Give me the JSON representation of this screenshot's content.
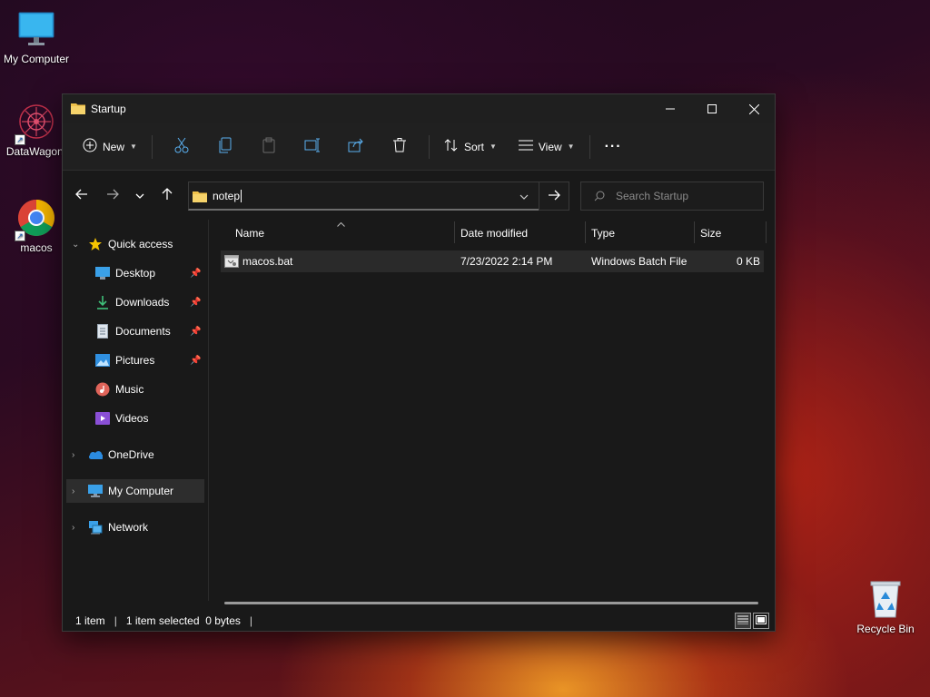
{
  "desktop": {
    "icons": [
      {
        "label": "My Computer",
        "icon": "monitor-icon"
      },
      {
        "label": "DataWagon.",
        "icon": "datawagon-icon"
      },
      {
        "label": "macos",
        "icon": "chrome-icon"
      },
      {
        "label": "Recycle Bin",
        "icon": "recycle-bin-icon"
      }
    ]
  },
  "window": {
    "title": "Startup",
    "toolbar": {
      "new_label": "New",
      "sort_label": "Sort",
      "view_label": "View"
    },
    "address": {
      "value": "notep"
    },
    "search": {
      "placeholder": "Search Startup"
    },
    "sidebar": {
      "quick_access": "Quick access",
      "items": [
        {
          "label": "Desktop",
          "icon": "desktop-icon",
          "pinned": true
        },
        {
          "label": "Downloads",
          "icon": "download-icon",
          "pinned": true
        },
        {
          "label": "Documents",
          "icon": "document-icon",
          "pinned": true
        },
        {
          "label": "Pictures",
          "icon": "pictures-icon",
          "pinned": true
        },
        {
          "label": "Music",
          "icon": "music-icon",
          "pinned": false
        },
        {
          "label": "Videos",
          "icon": "videos-icon",
          "pinned": false
        }
      ],
      "onedrive": "OneDrive",
      "my_computer": "My Computer",
      "network": "Network"
    },
    "columns": [
      "Name",
      "Date modified",
      "Type",
      "Size"
    ],
    "files": [
      {
        "name": "macos.bat",
        "date": "7/23/2022 2:14 PM",
        "type": "Windows Batch File",
        "size": "0 KB"
      }
    ],
    "status": {
      "count": "1 item",
      "selected": "1 item selected  0 bytes"
    }
  },
  "colors": {
    "accent": "#0078d4",
    "folder": "#f0c24b"
  }
}
